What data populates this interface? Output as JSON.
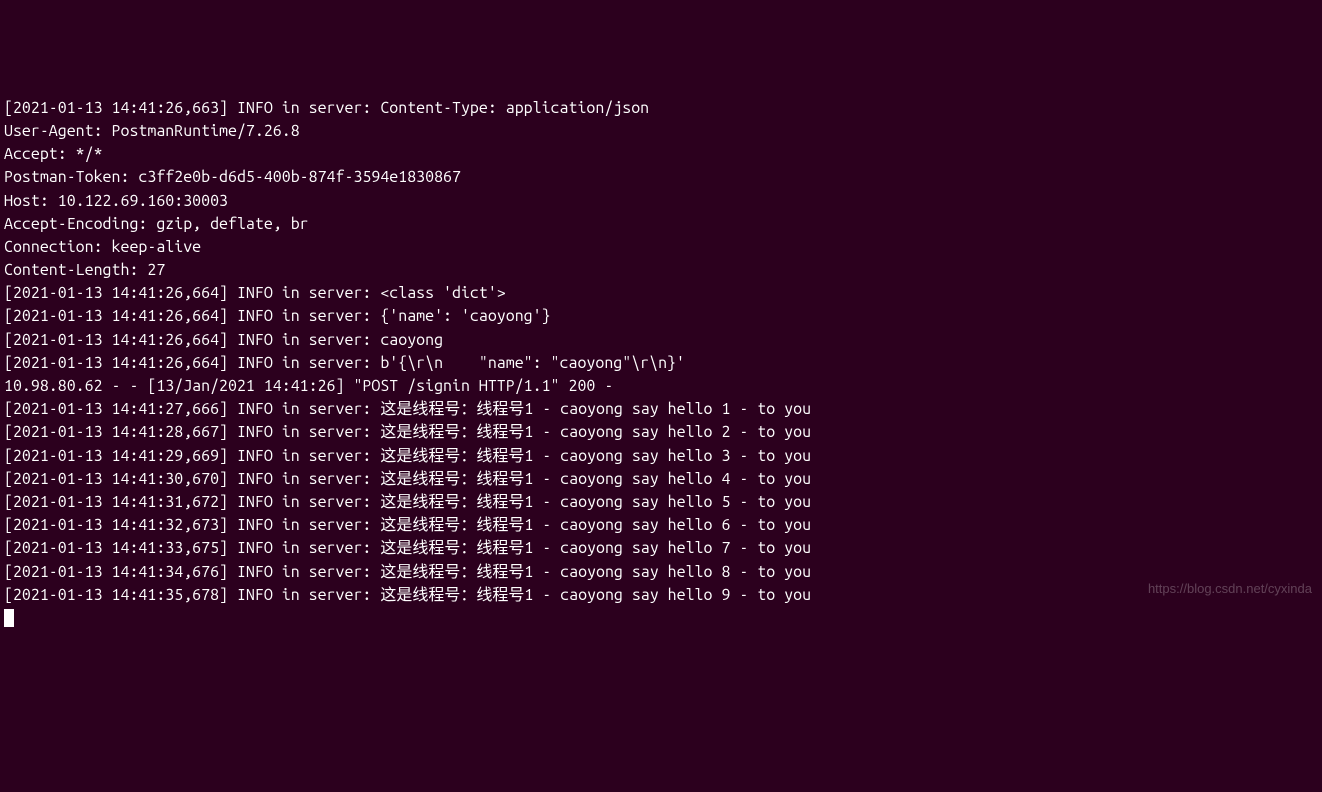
{
  "terminal": {
    "lines": [
      "[2021-01-13 14:41:26,663] INFO in server: Content-Type: application/json",
      "User-Agent: PostmanRuntime/7.26.8",
      "Accept: */*",
      "Postman-Token: c3ff2e0b-d6d5-400b-874f-3594e1830867",
      "Host: 10.122.69.160:30003",
      "Accept-Encoding: gzip, deflate, br",
      "Connection: keep-alive",
      "Content-Length: 27",
      "",
      "",
      "[2021-01-13 14:41:26,664] INFO in server: <class 'dict'>",
      "[2021-01-13 14:41:26,664] INFO in server: {'name': 'caoyong'}",
      "[2021-01-13 14:41:26,664] INFO in server: caoyong",
      "[2021-01-13 14:41:26,664] INFO in server: b'{\\r\\n    \"name\": \"caoyong\"\\r\\n}'",
      "10.98.80.62 - - [13/Jan/2021 14:41:26] \"POST /signin HTTP/1.1\" 200 -",
      "[2021-01-13 14:41:27,666] INFO in server: 这是线程号：线程号1 - caoyong say hello 1 - to you",
      "[2021-01-13 14:41:28,667] INFO in server: 这是线程号：线程号1 - caoyong say hello 2 - to you",
      "[2021-01-13 14:41:29,669] INFO in server: 这是线程号：线程号1 - caoyong say hello 3 - to you",
      "[2021-01-13 14:41:30,670] INFO in server: 这是线程号：线程号1 - caoyong say hello 4 - to you",
      "[2021-01-13 14:41:31,672] INFO in server: 这是线程号：线程号1 - caoyong say hello 5 - to you",
      "[2021-01-13 14:41:32,673] INFO in server: 这是线程号：线程号1 - caoyong say hello 6 - to you",
      "[2021-01-13 14:41:33,675] INFO in server: 这是线程号：线程号1 - caoyong say hello 7 - to you",
      "[2021-01-13 14:41:34,676] INFO in server: 这是线程号：线程号1 - caoyong say hello 8 - to you",
      "[2021-01-13 14:41:35,678] INFO in server: 这是线程号：线程号1 - caoyong say hello 9 - to you"
    ]
  },
  "watermark": "https://blog.csdn.net/cyxinda"
}
